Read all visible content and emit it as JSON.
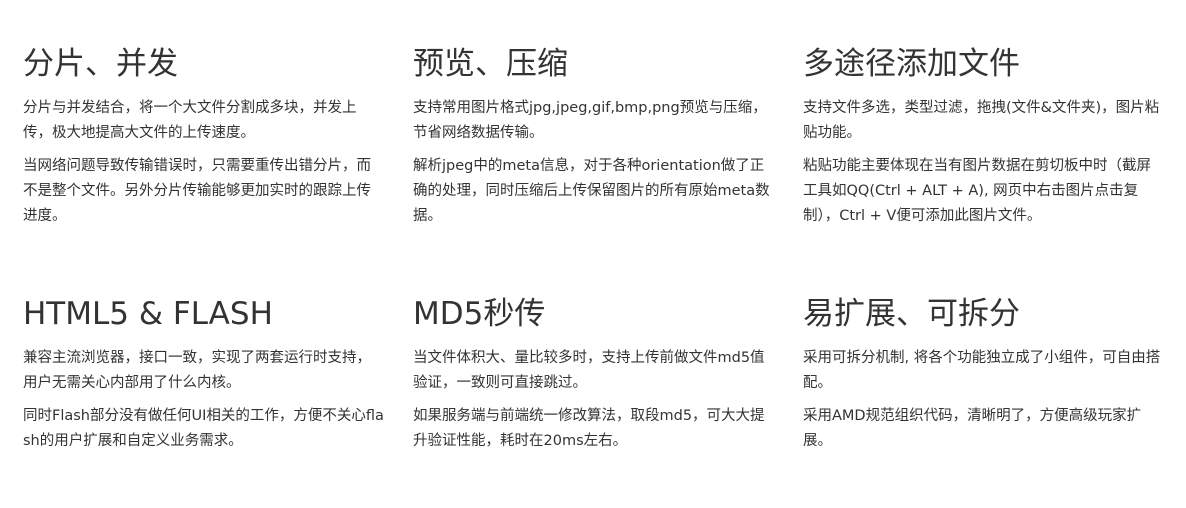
{
  "features": [
    {
      "title": "分片、并发",
      "paragraphs": [
        "分片与并发结合，将一个大文件分割成多块，并发上传，极大地提高大文件的上传速度。",
        "当网络问题导致传输错误时，只需要重传出错分片，而不是整个文件。另外分片传输能够更加实时的跟踪上传进度。"
      ]
    },
    {
      "title": "预览、压缩",
      "paragraphs": [
        "支持常用图片格式jpg,jpeg,gif,bmp,png预览与压缩，节省网络数据传输。",
        "解析jpeg中的meta信息，对于各种orientation做了正确的处理，同时压缩后上传保留图片的所有原始meta数据。"
      ]
    },
    {
      "title": "多途径添加文件",
      "paragraphs": [
        "支持文件多选，类型过滤，拖拽(文件&文件夹)，图片粘贴功能。",
        "粘贴功能主要体现在当有图片数据在剪切板中时（截屏工具如QQ(Ctrl + ALT + A), 网页中右击图片点击复制），Ctrl + V便可添加此图片文件。"
      ]
    },
    {
      "title": "HTML5 & FLASH",
      "paragraphs": [
        "兼容主流浏览器，接口一致，实现了两套运行时支持，用户无需关心内部用了什么内核。",
        "同时Flash部分没有做任何UI相关的工作，方便不关心flash的用户扩展和自定义业务需求。"
      ]
    },
    {
      "title": "MD5秒传",
      "paragraphs": [
        "当文件体积大、量比较多时，支持上传前做文件md5值验证，一致则可直接跳过。",
        "如果服务端与前端统一修改算法，取段md5，可大大提升验证性能，耗时在20ms左右。"
      ]
    },
    {
      "title": "易扩展、可拆分",
      "paragraphs": [
        "采用可拆分机制, 将各个功能独立成了小组件，可自由搭配。",
        "采用AMD规范组织代码，清晰明了，方便高级玩家扩展。"
      ]
    }
  ]
}
